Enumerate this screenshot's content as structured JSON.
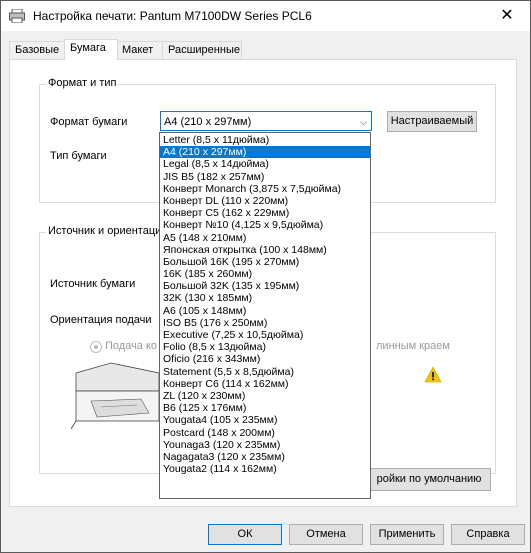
{
  "window": {
    "title": "Настройка печати: Pantum M7100DW Series PCL6",
    "close_glyph": "✕"
  },
  "tabs": [
    {
      "label": "Базовые"
    },
    {
      "label": "Бумага"
    },
    {
      "label": "Макет"
    },
    {
      "label": "Расширенные"
    }
  ],
  "format_group": {
    "title": "Формат и тип",
    "paper_size_label": "Формат бумаги",
    "paper_size_value": "A4 (210 x 297мм)",
    "custom_button": "Настраиваемый",
    "paper_type_label": "Тип бумаги"
  },
  "source_group": {
    "title": "Источник и ориентаци",
    "paper_source_label": "Источник бумаги",
    "orientation_label": "Ориентация подачи",
    "radio_left_label": "Подача ко",
    "radio_right_label": "линным краем"
  },
  "defaults_button": "ройки по умолчанию",
  "dropdown_items": [
    "Letter (8,5 x 11дюйма)",
    "A4 (210 x 297мм)",
    "Legal (8,5 x 14дюйма)",
    "JIS B5 (182 x 257мм)",
    "Конверт Monarch (3,875 x 7,5дюйма)",
    "Конверт DL (110 x 220мм)",
    "Конверт C5 (162 x 229мм)",
    "Конверт №10 (4,125 x 9,5дюйма)",
    "A5 (148 x 210мм)",
    "Японская открытка (100 x 148мм)",
    "Большой 16K (195 x 270мм)",
    "16K (185 x 260мм)",
    "Большой 32K (135 x 195мм)",
    "32K (130 x 185мм)",
    "A6 (105 x 148мм)",
    "ISO B5 (176 x 250мм)",
    "Executive (7,25 x 10,5дюйма)",
    "Folio (8,5 x 13дюйма)",
    "Oficio (216 x 343мм)",
    "Statement (5,5 x 8,5дюйма)",
    "Конверт C6 (114 x 162мм)",
    "ZL (120 x 230мм)",
    "B6 (125 x 176мм)",
    "Yougata4 (105 x 235мм)",
    "Postcard (148 x 200мм)",
    "Younaga3 (120 x 235мм)",
    "Nagagata3 (120 x 235мм)",
    "Yougata2 (114 x 162мм)"
  ],
  "dropdown_selected_index": 1,
  "footer": {
    "ok": "ОК",
    "cancel": "Отмена",
    "apply": "Применить",
    "help": "Справка"
  },
  "colors": {
    "accent": "#0078d7",
    "warning": "#f5c400"
  }
}
